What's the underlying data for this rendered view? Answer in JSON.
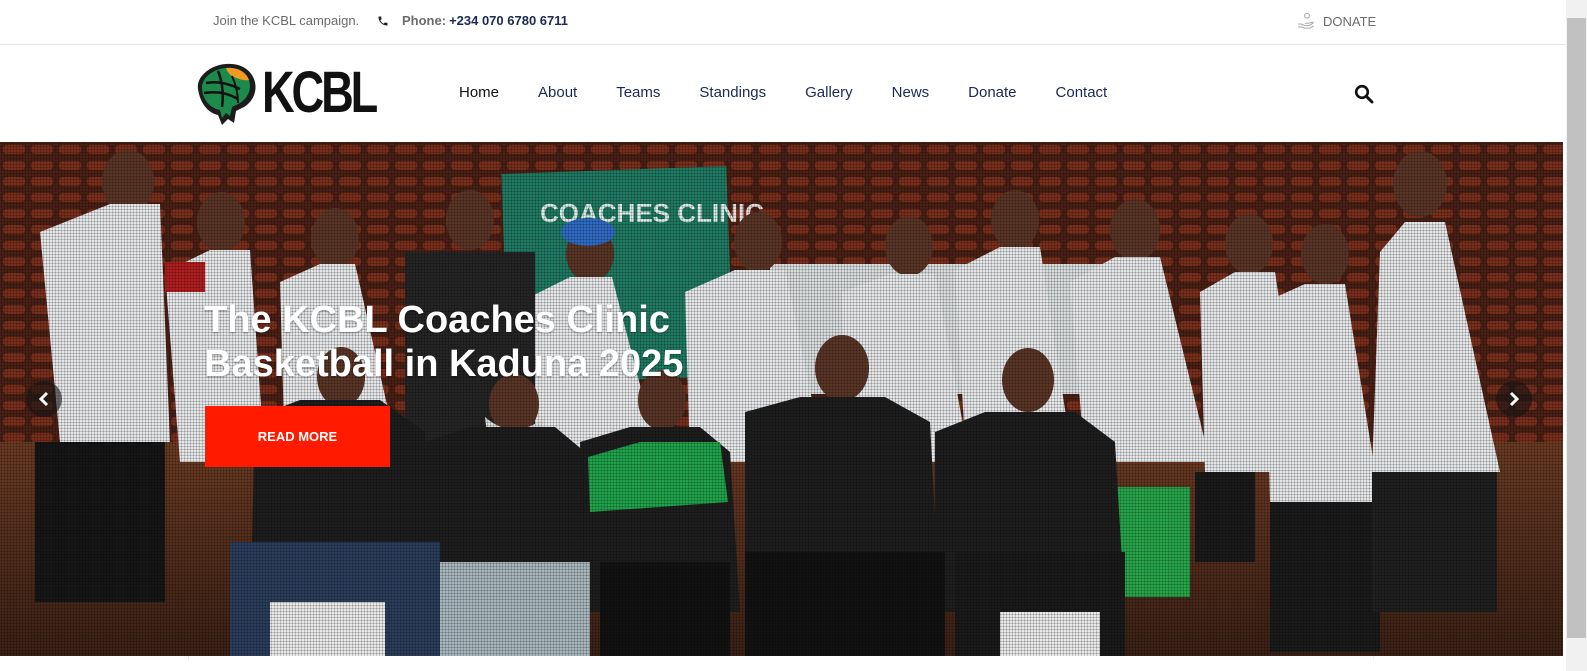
{
  "topbar": {
    "campaign_text": "Join the KCBL campaign.",
    "phone_label": "Phone:",
    "phone_number": "+234 070 6780 6711",
    "donate_label": "DONATE",
    "phone_icon": "phone-icon",
    "donate_icon": "hand-coin-icon"
  },
  "header": {
    "logo_text": "KCBL",
    "search_icon": "search-icon",
    "nav": [
      {
        "label": "Home"
      },
      {
        "label": "About"
      },
      {
        "label": "Teams"
      },
      {
        "label": "Standings"
      },
      {
        "label": "Gallery"
      },
      {
        "label": "News"
      },
      {
        "label": "Donate"
      },
      {
        "label": "Contact"
      }
    ]
  },
  "hero": {
    "title": "The KCBL Coaches Clinic Basketball in Kaduna 2025",
    "button_label": "READ MORE",
    "banner_text": "COACHES CLINIC",
    "prev_icon": "chevron-left-icon",
    "next_icon": "chevron-right-icon"
  },
  "colors": {
    "brand_navy": "#1a2a52",
    "cta_red": "#ff1a00",
    "logo_green": "#1c8a4a",
    "logo_orange": "#f29a1f"
  }
}
